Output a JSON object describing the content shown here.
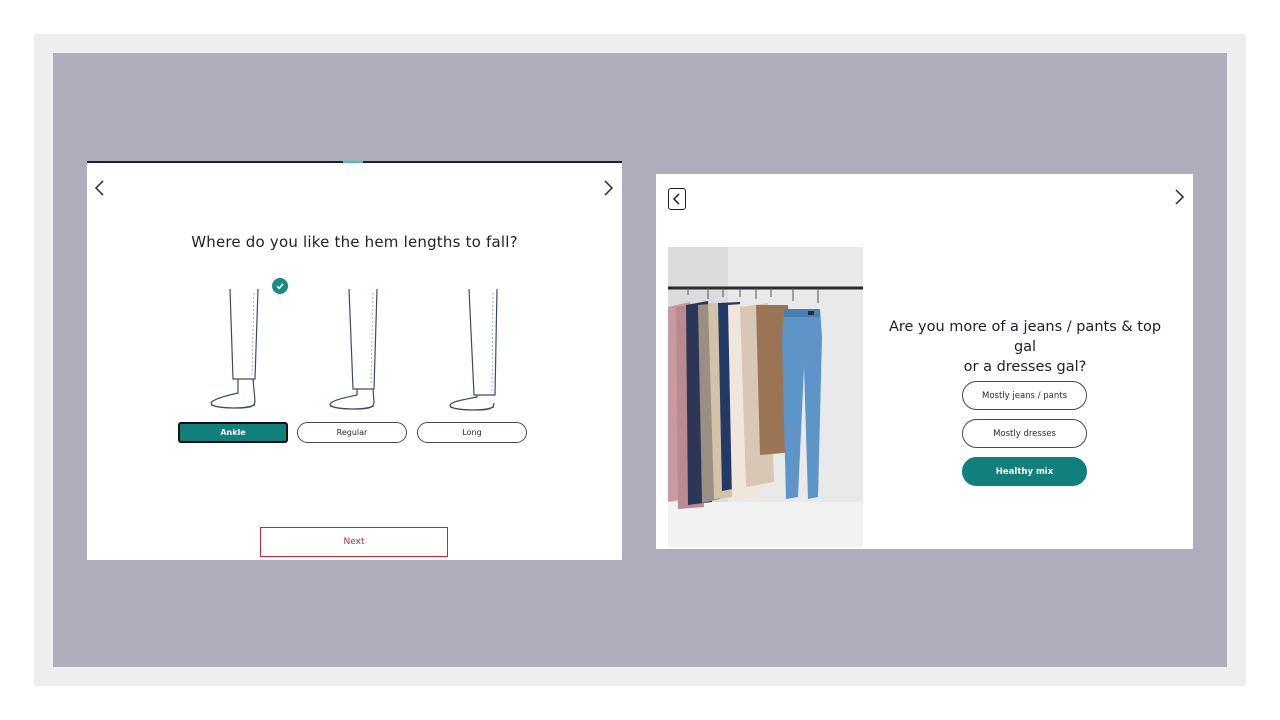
{
  "left_screen": {
    "question": "Where do you like the hem lengths to fall?",
    "options": [
      {
        "label": "Ankle",
        "selected": true
      },
      {
        "label": "Regular",
        "selected": false
      },
      {
        "label": "Long",
        "selected": false
      }
    ],
    "next_label": "Next",
    "icons": {
      "back": "chevron-left-icon",
      "forward": "chevron-right-icon",
      "selected_check": "check-circle-icon"
    }
  },
  "right_screen": {
    "question_line1": "Are you more of a jeans / pants & top gal",
    "question_line2": "or a dresses gal?",
    "options": [
      {
        "label": "Mostly jeans / pants",
        "selected": false
      },
      {
        "label": "Mostly dresses",
        "selected": false
      },
      {
        "label": "Healthy mix",
        "selected": true
      }
    ],
    "icons": {
      "back": "chevron-left-icon",
      "forward": "chevron-right-icon"
    }
  },
  "colors": {
    "accent_teal": "#117f7c",
    "progress_teal": "#43c0b8",
    "next_red": "#c8242f",
    "backdrop": "#adadbb"
  }
}
